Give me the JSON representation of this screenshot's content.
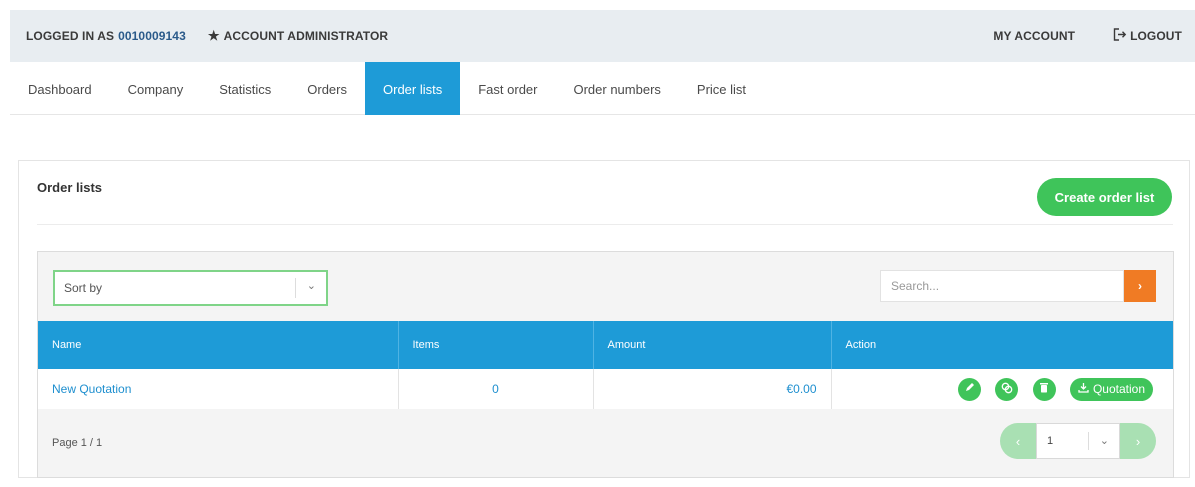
{
  "topbar": {
    "logged_in_label": "LOGGED IN AS",
    "account_number": "0010009143",
    "role_icon": "star-icon",
    "role": "ACCOUNT ADMINISTRATOR",
    "my_account": "MY ACCOUNT",
    "logout_icon": "logout-icon",
    "logout": "LOGOUT"
  },
  "nav": {
    "tabs": [
      {
        "label": "Dashboard"
      },
      {
        "label": "Company"
      },
      {
        "label": "Statistics"
      },
      {
        "label": "Orders"
      },
      {
        "label": "Order lists",
        "active": true
      },
      {
        "label": "Fast order"
      },
      {
        "label": "Order numbers"
      },
      {
        "label": "Price list"
      }
    ]
  },
  "panel": {
    "title": "Order lists",
    "create_button": "Create order list"
  },
  "filters": {
    "sort_value": "Sort by",
    "search_placeholder": "Search..."
  },
  "table": {
    "columns": [
      "Name",
      "Items",
      "Amount",
      "Action"
    ],
    "rows": [
      {
        "name": "New Quotation",
        "items": "0",
        "amount": "€0.00"
      }
    ],
    "actions": {
      "icons": [
        "edit-icon",
        "copy-icon",
        "delete-icon"
      ],
      "quotation_label": "Quotation"
    }
  },
  "pagination": {
    "page_info": "Page 1 / 1",
    "page_select_value": "1"
  },
  "colors": {
    "primary_blue": "#1e9bd7",
    "accent_green": "#3fc45a",
    "search_orange": "#f07b24"
  }
}
